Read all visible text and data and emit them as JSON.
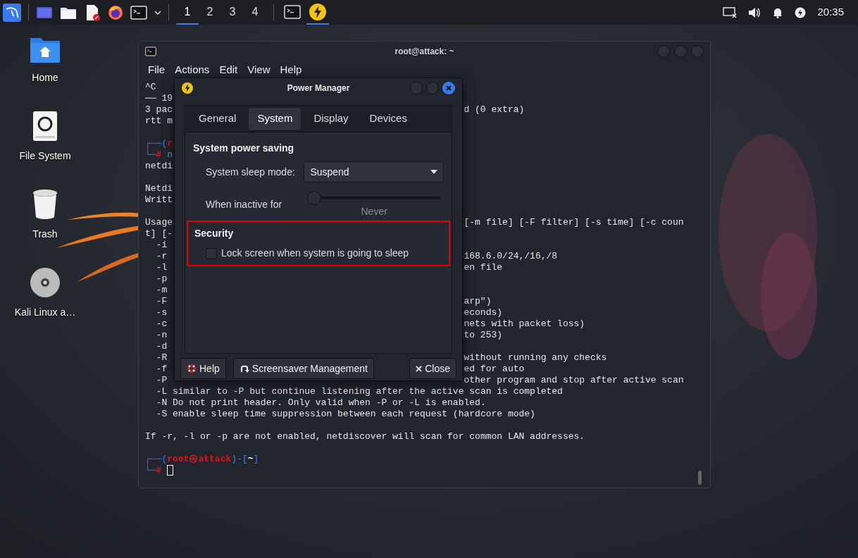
{
  "taskbar": {
    "workspaces": [
      {
        "label": "1",
        "selected": true
      },
      {
        "label": "2",
        "selected": false
      },
      {
        "label": "3",
        "selected": false
      },
      {
        "label": "4",
        "selected": false
      }
    ],
    "tasks": [
      {
        "kind": "terminal",
        "active": false
      },
      {
        "kind": "power",
        "active": true
      }
    ],
    "clock": "20:35"
  },
  "desktop_icons": [
    {
      "kind": "home",
      "label": "Home"
    },
    {
      "kind": "drive",
      "label": "File System"
    },
    {
      "kind": "trash",
      "label": "Trash"
    },
    {
      "kind": "disc",
      "label": "Kali Linux a…"
    }
  ],
  "terminal": {
    "title": "root@attack: ~",
    "menu": [
      "File",
      "Actions",
      "Edit",
      "View",
      "Help"
    ],
    "lines": [
      {
        "kind": "text",
        "left": "^C"
      },
      {
        "kind": "text",
        "left": "── 19"
      },
      {
        "kind": "text",
        "left": "3 pac",
        "right": "d (0 extra)"
      },
      {
        "kind": "text",
        "left": "rtt m"
      },
      {
        "kind": "blank"
      },
      {
        "kind": "prompt",
        "segments": [
          {
            "kind": "frame",
            "text": "┌──("
          },
          {
            "kind": "user",
            "text": "r"
          }
        ]
      },
      {
        "kind": "prompt",
        "segments": [
          {
            "kind": "frame",
            "text": "└─"
          },
          {
            "kind": "user",
            "text": "#"
          },
          {
            "kind": "command",
            "text": "n"
          }
        ]
      },
      {
        "kind": "text",
        "left": "netdi"
      },
      {
        "kind": "blank"
      },
      {
        "kind": "text",
        "left": "Netdi"
      },
      {
        "kind": "text",
        "left": "Writt"
      },
      {
        "kind": "blank"
      },
      {
        "kind": "text",
        "left": "Usage",
        "right": "[-m file] [-F filter] [-s time] [-c coun"
      },
      {
        "kind": "text",
        "left": "t] [-"
      },
      {
        "kind": "text",
        "left": "  -i"
      },
      {
        "kind": "text",
        "left": "  -r",
        "right": "168.6.0/24,/16,/8"
      },
      {
        "kind": "text",
        "left": "  -l",
        "right": "en file"
      },
      {
        "kind": "text",
        "left": "  -p"
      },
      {
        "kind": "text",
        "left": "  -m"
      },
      {
        "kind": "text",
        "left": "  -F",
        "right": "arp\")"
      },
      {
        "kind": "text",
        "left": "  -s",
        "right": "econds)"
      },
      {
        "kind": "text",
        "left": "  -c",
        "right": "nets with packet loss)"
      },
      {
        "kind": "text",
        "left": "  -n",
        "right": "to 253)"
      },
      {
        "kind": "text",
        "left": "  -d"
      },
      {
        "kind": "text",
        "left": "  -R",
        "right": "without running any checks"
      },
      {
        "kind": "text",
        "left": "  -f",
        "right": "ed for auto"
      },
      {
        "kind": "text",
        "left": "  -P",
        "right": "other program and stop after active scan"
      },
      {
        "kind": "text",
        "left": "  -L similar to -P but continue listening after the active scan is completed"
      },
      {
        "kind": "text",
        "left": "  -N Do not print header. Only valid when -P or -L is enabled."
      },
      {
        "kind": "text",
        "left": "  -S enable sleep time suppression between each request (hardcore mode)"
      },
      {
        "kind": "blank"
      },
      {
        "kind": "text",
        "left": "If -r, -l or -p are not enabled, netdiscover will scan for common LAN addresses."
      },
      {
        "kind": "blank"
      },
      {
        "kind": "prompt",
        "segments": [
          {
            "kind": "frame",
            "text": "┌──("
          },
          {
            "kind": "user",
            "text": "root㉿attack"
          },
          {
            "kind": "frame",
            "text": ")-["
          },
          {
            "kind": "path",
            "text": "~"
          },
          {
            "kind": "frame",
            "text": "]"
          }
        ]
      },
      {
        "kind": "prompt",
        "segments": [
          {
            "kind": "frame",
            "text": "└─"
          },
          {
            "kind": "user",
            "text": "#"
          }
        ],
        "cursor": true
      }
    ]
  },
  "dialog": {
    "title": "Power Manager",
    "tabs": [
      {
        "label": "General",
        "selected": false
      },
      {
        "label": "System",
        "selected": true
      },
      {
        "label": "Display",
        "selected": false
      },
      {
        "label": "Devices",
        "selected": false
      }
    ],
    "power_saving": {
      "heading": "System power saving",
      "sleep_mode_label": "System sleep mode:",
      "sleep_mode_value": "Suspend",
      "inactive_label": "When inactive for",
      "inactive_slider": {
        "level": 0
      },
      "inactive_reading": "Never"
    },
    "security": {
      "heading": "Security",
      "highlighted": true,
      "lock_screen": {
        "label": "Lock screen when system is going to sleep",
        "checked": false
      }
    },
    "buttons": [
      {
        "kind": "help",
        "label": "Help"
      },
      {
        "kind": "screensaver",
        "label": "Screensaver Management"
      },
      {
        "kind": "close",
        "label": "Close"
      }
    ]
  }
}
